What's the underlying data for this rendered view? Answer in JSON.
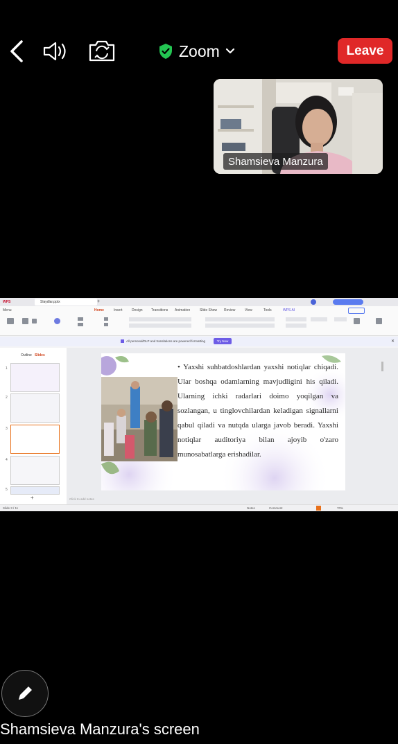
{
  "header": {
    "title": "Zoom",
    "leave_label": "Leave",
    "security_color": "#23c552",
    "icons": [
      "chevron-left-icon",
      "speaker-icon",
      "camera-flip-icon",
      "shield-check-icon",
      "chevron-down-icon"
    ]
  },
  "participant": {
    "name": "Shamsieva Manzura"
  },
  "shared_screen": {
    "app_tabs": [
      "WPS",
      "Slaydlar.pptx",
      "+"
    ],
    "menu": [
      "Menu",
      "Home",
      "Insert",
      "Design",
      "Transitions",
      "Animation",
      "Slide Show",
      "Review",
      "View",
      "Tools",
      "WPS AI"
    ],
    "active_menu": "Home",
    "notice_text": "All personal/DLP and translations are powered formatting",
    "notice_button": "Try Now",
    "panel_tabs": [
      "Outline",
      "Slides"
    ],
    "slide_numbers": [
      "1",
      "2",
      "3",
      "4",
      "5"
    ],
    "slide_text": "• Yaxshi suhbatdoshlardan yaxshi notiqlar chiqadi. Ular boshqa odamlarning mavjudligini his qiladi. Ularning ichki radarlari doimo yoqilgan va sozlangan, u tinglovchilardan keladigan signallarni qabul qiladi va nutqda ularga javob beradi. Yaxshi notiqlar auditoriya bilan ajoyib o'zaro munosabatlarga erishadilar.",
    "notes_placeholder": "Click to add notes",
    "status_left": "Slide 3 / 11",
    "status_notes": "Notes",
    "status_comment": "Comment",
    "zoom_level": "70%"
  },
  "footer": {
    "annotate_icon": "pencil-icon",
    "screen_label": "Shamsieva Manzura's screen"
  }
}
